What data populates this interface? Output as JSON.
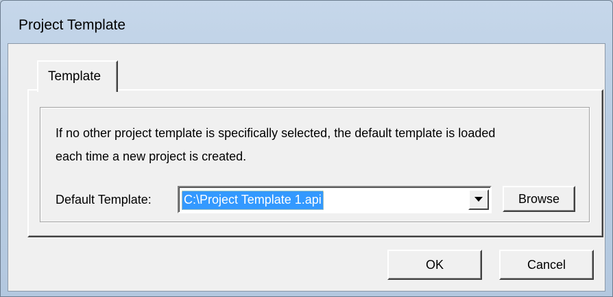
{
  "window": {
    "title": "Project Template"
  },
  "tabs": [
    {
      "label": "Template",
      "selected": true
    }
  ],
  "template_tab": {
    "description_line1": "If no other project template is specifically selected, the default template is loaded",
    "description_line2": "each time a new project is created.",
    "default_template_label": "Default Template:",
    "default_template_value": "C:\\Project Template 1.api",
    "browse_label": "Browse"
  },
  "buttons": {
    "ok_label": "OK",
    "cancel_label": "Cancel"
  },
  "icons": {
    "dropdown": "chevron-down-icon"
  },
  "colors": {
    "selection_bg": "#3399ff",
    "dialog_bg": "#f0f0f0",
    "frame": "#b9cde3"
  }
}
